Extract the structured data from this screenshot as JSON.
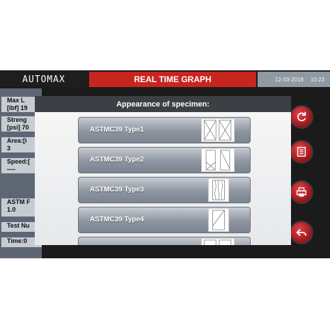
{
  "header": {
    "logo": "AUTOMAX",
    "title": "REAL TIME GRAPH",
    "date": "12-03-2019",
    "time": "10:23"
  },
  "left_panel": {
    "items": [
      {
        "line1": "Max L",
        "line2": "[lbf]  19"
      },
      {
        "line1": "Streng",
        "line2": "[psi] 70"
      },
      {
        "line1": "Area:[i",
        "line2": "3"
      },
      {
        "line1": "Speed:[",
        "line2": "----"
      },
      {
        "line1": "ASTM F",
        "line2": "1.0"
      },
      {
        "line1": "Test Nu",
        "line2": ""
      },
      {
        "line1": "Time:0",
        "line2": ""
      }
    ]
  },
  "modal": {
    "title": "Appearance of specimen:",
    "options": [
      {
        "label": "ASTMC39 Type1",
        "icon": "type1-fracture-icon"
      },
      {
        "label": "ASTMC39 Type2",
        "icon": "type2-fracture-icon"
      },
      {
        "label": "ASTMC39 Type3",
        "icon": "type3-fracture-icon"
      },
      {
        "label": "ASTMC39 Type4",
        "icon": "type4-fracture-icon"
      },
      {
        "label": "",
        "icon": "type5-fracture-icon"
      }
    ]
  },
  "side_buttons": [
    {
      "icon": "refresh-icon"
    },
    {
      "icon": "list-icon"
    },
    {
      "icon": "print-icon"
    },
    {
      "icon": "back-arrow-icon"
    }
  ],
  "colors": {
    "title_bar": "#c8251f",
    "button_red": "#c9282f",
    "option_gradient": "#8d95a0"
  }
}
